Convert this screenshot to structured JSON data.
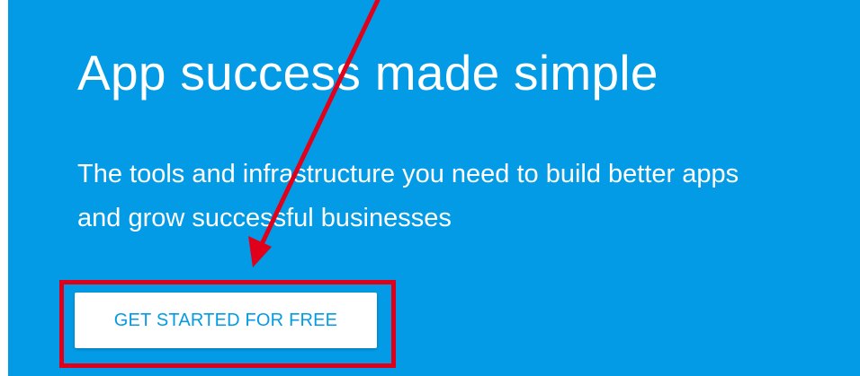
{
  "hero": {
    "headline": "App success made simple",
    "subhead": "The tools and infrastructure you need to build better apps and grow successful businesses",
    "cta_label": "GET STARTED FOR FREE"
  },
  "colors": {
    "hero_background": "#039be5",
    "text": "#ffffff",
    "cta_background": "#ffffff",
    "cta_text": "#039be5",
    "annotation": "#e0001a"
  },
  "annotation": {
    "arrow_icon": "arrow-pointer-icon",
    "highlight": "cta-highlight-box"
  }
}
